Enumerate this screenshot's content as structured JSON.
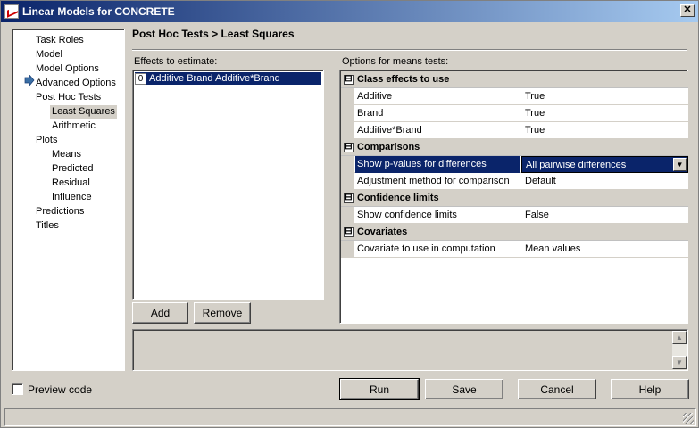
{
  "window": {
    "title": "Linear Models for CONCRETE",
    "close_glyph": "✕"
  },
  "nav": {
    "items": [
      {
        "label": "Task Roles",
        "indent": 0
      },
      {
        "label": "Model",
        "indent": 0
      },
      {
        "label": "Model Options",
        "indent": 0
      },
      {
        "label": "Advanced Options",
        "indent": 0
      },
      {
        "label": "Post Hoc Tests",
        "indent": 0
      },
      {
        "label": "Least Squares",
        "indent": 1,
        "selected": true
      },
      {
        "label": "Arithmetic",
        "indent": 1
      },
      {
        "label": "Plots",
        "indent": 0
      },
      {
        "label": "Means",
        "indent": 1
      },
      {
        "label": "Predicted",
        "indent": 1
      },
      {
        "label": "Residual",
        "indent": 1
      },
      {
        "label": "Influence",
        "indent": 1
      },
      {
        "label": "Predictions",
        "indent": 0
      },
      {
        "label": "Titles",
        "indent": 0
      }
    ],
    "current_icon": "arrow-right-icon",
    "accent_color": "#3a6ea5"
  },
  "page": {
    "title": "Post Hoc Tests > Least Squares"
  },
  "effects": {
    "label": "Effects to estimate:",
    "items": [
      {
        "index": "0",
        "text": "Additive Brand Additive*Brand"
      }
    ],
    "add_label": "Add",
    "remove_label": "Remove"
  },
  "options": {
    "label": "Options for means tests:",
    "sections": [
      {
        "title": "Class effects to use",
        "toggle": "⊟",
        "rows": [
          {
            "name": "Additive",
            "value": "True"
          },
          {
            "name": "Brand",
            "value": "True"
          },
          {
            "name": "Additive*Brand",
            "value": "True"
          }
        ]
      },
      {
        "title": "Comparisons",
        "toggle": "⊟",
        "rows": [
          {
            "name": "Show p-values for differences",
            "value": "All pairwise differences",
            "selected": true
          },
          {
            "name": "Adjustment method for comparison",
            "value": "Default"
          }
        ]
      },
      {
        "title": "Confidence limits",
        "toggle": "⊟",
        "rows": [
          {
            "name": "Show confidence limits",
            "value": "False"
          }
        ]
      },
      {
        "title": "Covariates",
        "toggle": "⊟",
        "rows": [
          {
            "name": "Covariate to use in computation",
            "value": "Mean values"
          }
        ]
      }
    ]
  },
  "footer": {
    "preview_label": "Preview code",
    "preview_checked": false,
    "run_label": "Run",
    "save_label": "Save",
    "cancel_label": "Cancel",
    "help_label": "Help"
  },
  "colors": {
    "selection": "#0a246a",
    "face": "#d4d0c8"
  }
}
